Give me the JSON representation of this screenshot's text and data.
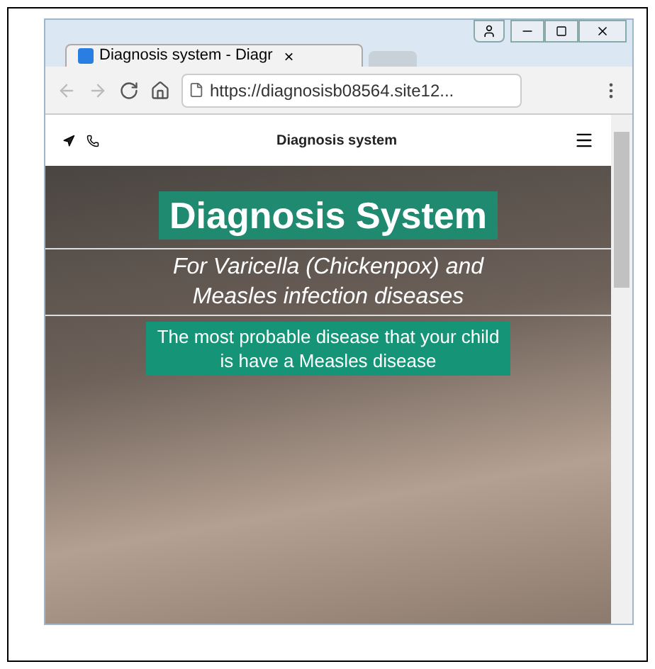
{
  "tab": {
    "title": "Diagnosis system - Diagr",
    "close": "×"
  },
  "address_bar": {
    "value": "https://diagnosisb08564.site12..."
  },
  "site_header": {
    "title": "Diagnosis system"
  },
  "hero": {
    "title": "Diagnosis System",
    "subtitle_lines": [
      "For Varicella (Chickenpox) and",
      "Measles infection diseases"
    ],
    "result_lines": [
      "The most probable disease that your child",
      "is have a Measles disease"
    ]
  }
}
